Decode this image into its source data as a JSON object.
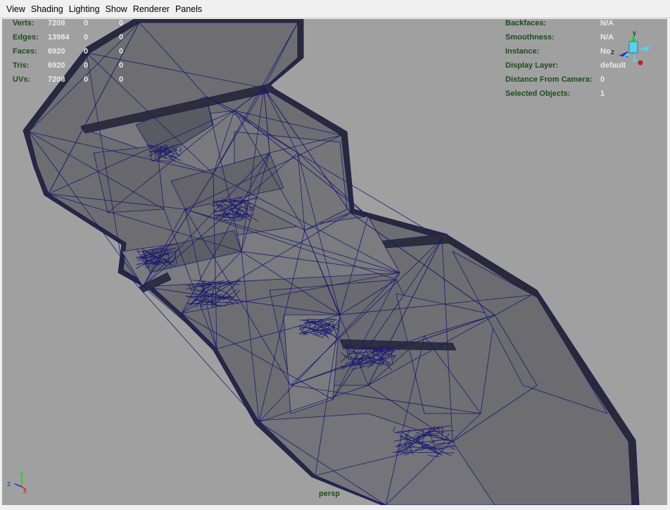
{
  "menubar": {
    "items": [
      "View",
      "Shading",
      "Lighting",
      "Show",
      "Renderer",
      "Panels"
    ]
  },
  "hud_left": [
    {
      "label": "Verts:",
      "v1": "7208",
      "v2": "0",
      "v3": "0"
    },
    {
      "label": "Edges:",
      "v1": "13984",
      "v2": "0",
      "v3": "0"
    },
    {
      "label": "Faces:",
      "v1": "6920",
      "v2": "0",
      "v3": "0"
    },
    {
      "label": "Tris:",
      "v1": "6920",
      "v2": "0",
      "v3": "0"
    },
    {
      "label": "UVs:",
      "v1": "7208",
      "v2": "0",
      "v3": "0"
    }
  ],
  "hud_right": [
    {
      "label": "Backfaces:",
      "value": "N/A"
    },
    {
      "label": "Smoothness:",
      "value": "N/A"
    },
    {
      "label": "Instance:",
      "value": "No"
    },
    {
      "label": "Display Layer:",
      "value": "default"
    },
    {
      "label": "Distance From Camera:",
      "value": "0"
    },
    {
      "label": "Selected Objects:",
      "value": "1"
    }
  ],
  "view_cube": {
    "axis_y": "y",
    "axis_z": "z"
  },
  "axis_gizmo": {
    "x": "x",
    "y": "Y",
    "z": "z"
  },
  "camera_label": "persp",
  "colors": {
    "viewport_bg": "#a0a0a0",
    "mesh_face": "#6e6e72",
    "wire": "#1a1a6e",
    "hud_label": "#1d4d1d",
    "hud_value": "#eaeaea",
    "axis_x": "#e02020",
    "axis_y": "#20d020",
    "axis_z": "#2030d0"
  }
}
